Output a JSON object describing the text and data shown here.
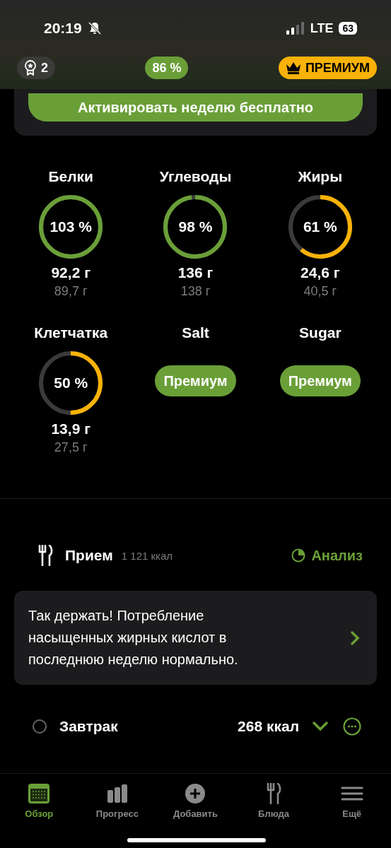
{
  "status_bar": {
    "time": "20:19",
    "network": "LTE",
    "battery": "63"
  },
  "header": {
    "badge_count": "2",
    "score": "86 %",
    "premium": "ПРЕМИУМ"
  },
  "promo": {
    "button": "Активировать неделю бесплатно"
  },
  "nutrients": [
    {
      "kind": "ring",
      "name": "Белки",
      "percent": "103 %",
      "level": 1,
      "color": "#6a9f38",
      "amount": "92,2 г",
      "target": "89,7 г"
    },
    {
      "kind": "ring",
      "name": "Углеводы",
      "percent": "98 %",
      "level": 0.98,
      "color": "#6a9f38",
      "amount": "136 г",
      "target": "138 г"
    },
    {
      "kind": "ring",
      "name": "Жиры",
      "percent": "61 %",
      "level": 0.61,
      "color": "#f9b208",
      "amount": "24,6 г",
      "target": "40,5 г"
    },
    {
      "kind": "ring",
      "name": "Клетчатка",
      "percent": "50 %",
      "level": 0.5,
      "color": "#f9b208",
      "amount": "13,9 г",
      "target": "27,5 г"
    },
    {
      "kind": "locked",
      "name": "Salt",
      "button": "Премиум"
    },
    {
      "kind": "locked",
      "name": "Sugar",
      "button": "Премиум"
    }
  ],
  "meals": {
    "title": "Прием",
    "calories": "1 121 ккал",
    "analysis": "Анализ"
  },
  "tip": {
    "text": "Так держать! Потребление насыщенных жирных кислот в последнюю неделю нормально."
  },
  "meal_rows": [
    {
      "name": "Завтрак",
      "calories": "268 ккал",
      "checked": false
    }
  ],
  "tab_bar": [
    {
      "label": "Обзор",
      "selected": true,
      "kind": "calendar"
    },
    {
      "label": "Прогресс",
      "selected": false,
      "kind": "bars"
    },
    {
      "label": "Добавить",
      "selected": false,
      "kind": "plus"
    },
    {
      "label": "Блюда",
      "selected": false,
      "kind": "cutlery"
    },
    {
      "label": "Ещё",
      "selected": false,
      "kind": "menu"
    }
  ]
}
